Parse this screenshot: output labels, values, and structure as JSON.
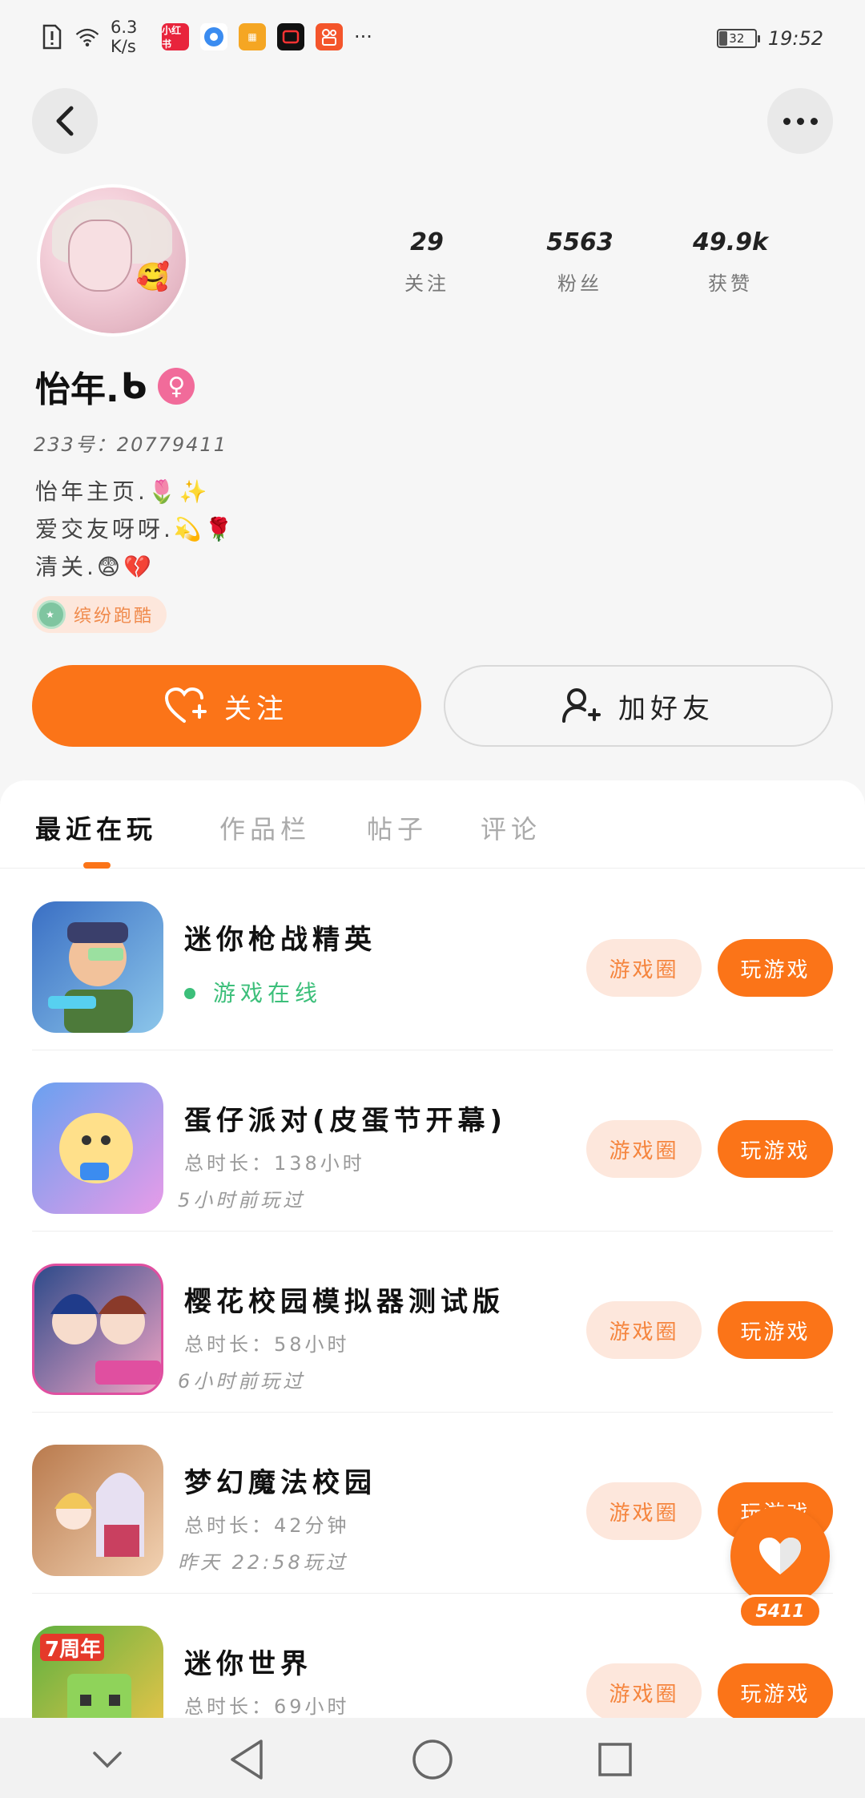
{
  "status_bar": {
    "net_speed": "6.3\nK/s",
    "battery": "32",
    "time": "19:52",
    "more": "···"
  },
  "profile": {
    "name": "怡年.",
    "name_glyph": "ᑲ",
    "uid_label": "233号：20779411",
    "bio_lines": [
      "怡年主页.🌷✨",
      "爱交友呀呀.💫🌹",
      "清关.😨💔"
    ],
    "badge": "缤纷跑酷",
    "avatar_emoji": "🥰"
  },
  "stats": [
    {
      "value": "29",
      "label": "关注"
    },
    {
      "value": "5563",
      "label": "粉丝"
    },
    {
      "value": "49.9k",
      "label": "获赞"
    }
  ],
  "actions": {
    "follow": "关注",
    "add_friend": "加好友"
  },
  "tabs": [
    "最近在玩",
    "作品栏",
    "帖子",
    "评论"
  ],
  "games": [
    {
      "name": "迷你枪战精英",
      "online": "游戏在线",
      "circle": "游戏圈",
      "play": "玩游戏",
      "colors": [
        "#3a6fc4",
        "#8cc6ea"
      ]
    },
    {
      "name": "蛋仔派对(皮蛋节开幕)",
      "duration": "总时长：138小时",
      "last": "5小时前玩过",
      "circle": "游戏圈",
      "play": "玩游戏",
      "colors": [
        "#6aa0f0",
        "#e79be8"
      ]
    },
    {
      "name": "樱花校园模拟器测试版",
      "duration": "总时长：58小时",
      "last": "6小时前玩过",
      "circle": "游戏圈",
      "play": "玩游戏",
      "colors": [
        "#2d4a8a",
        "#f2a4c4"
      ]
    },
    {
      "name": "梦幻魔法校园",
      "duration": "总时长：42分钟",
      "last": "昨天 22:58玩过",
      "circle": "游戏圈",
      "play": "玩游戏",
      "colors": [
        "#b97a4d",
        "#f2d2b2"
      ]
    },
    {
      "name": "迷你世界",
      "duration": "总时长：69小时",
      "circle": "游戏圈",
      "play": "玩游戏",
      "colors": [
        "#5fb140",
        "#f5c64a"
      ]
    }
  ],
  "float_like": {
    "count": "5411"
  },
  "theme": {
    "accent": "#fb7418",
    "accent_light": "#fde7dc",
    "online": "#3cbf7a"
  }
}
